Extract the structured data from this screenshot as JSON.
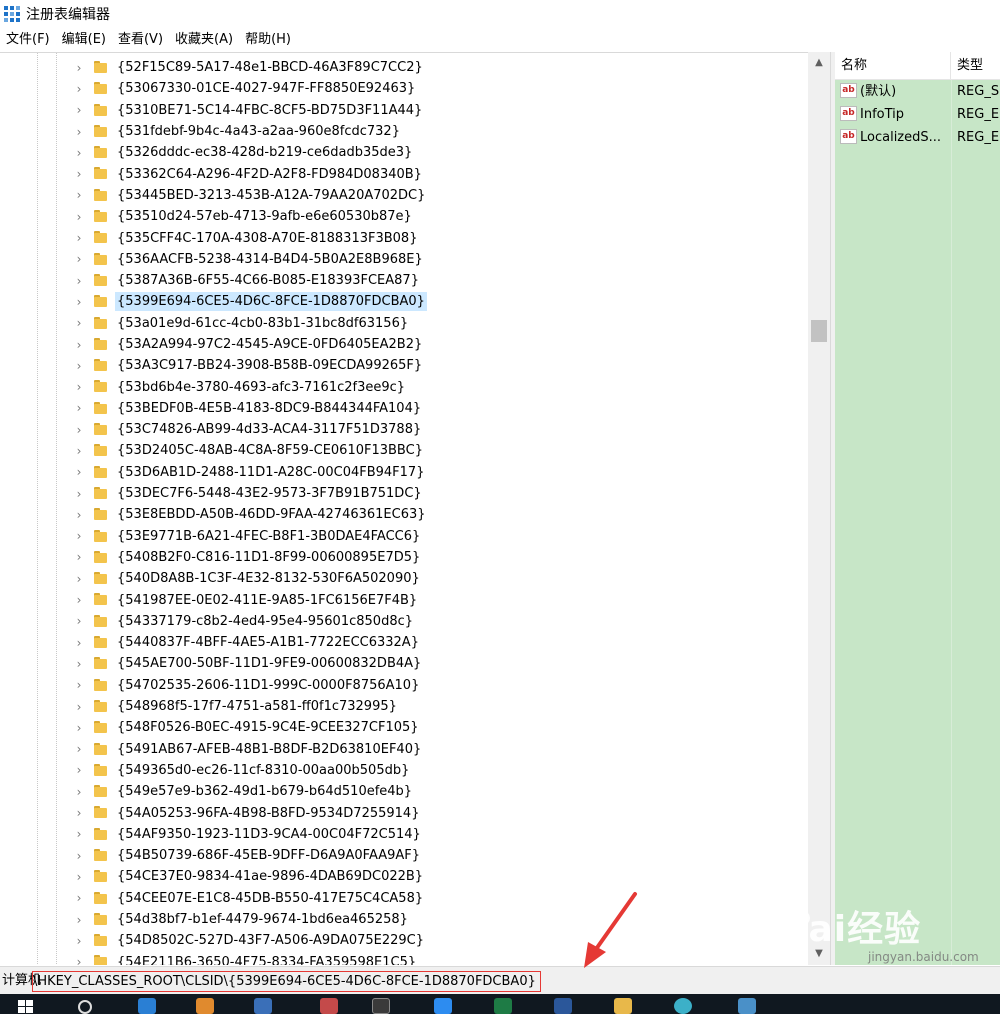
{
  "window": {
    "title": "注册表编辑器"
  },
  "menu": [
    "文件(F)",
    "编辑(E)",
    "查看(V)",
    "收藏夹(A)",
    "帮助(H)"
  ],
  "tree": {
    "selected_index": 11,
    "items": [
      "{52F15C89-5A17-48e1-BBCD-46A3F89C7CC2}",
      "{53067330-01CE-4027-947F-FF8850E92463}",
      "{5310BE71-5C14-4FBC-8CF5-BD75D3F11A44}",
      "{531fdebf-9b4c-4a43-a2aa-960e8fcdc732}",
      "{5326dddc-ec38-428d-b219-ce6dadb35de3}",
      "{53362C64-A296-4F2D-A2F8-FD984D08340B}",
      "{53445BED-3213-453B-A12A-79AA20A702DC}",
      "{53510d24-57eb-4713-9afb-e6e60530b87e}",
      "{535CFF4C-170A-4308-A70E-8188313F3B08}",
      "{536AACFB-5238-4314-B4D4-5B0A2E8B968E}",
      "{5387A36B-6F55-4C66-B085-E18393FCEA87}",
      "{5399E694-6CE5-4D6C-8FCE-1D8870FDCBA0}",
      "{53a01e9d-61cc-4cb0-83b1-31bc8df63156}",
      "{53A2A994-97C2-4545-A9CE-0FD6405EA2B2}",
      "{53A3C917-BB24-3908-B58B-09ECDA99265F}",
      "{53bd6b4e-3780-4693-afc3-7161c2f3ee9c}",
      "{53BEDF0B-4E5B-4183-8DC9-B844344FA104}",
      "{53C74826-AB99-4d33-ACA4-3117F51D3788}",
      "{53D2405C-48AB-4C8A-8F59-CE0610F13BBC}",
      "{53D6AB1D-2488-11D1-A28C-00C04FB94F17}",
      "{53DEC7F6-5448-43E2-9573-3F7B91B751DC}",
      "{53E8EBDD-A50B-46DD-9FAA-42746361EC63}",
      "{53E9771B-6A21-4FEC-B8F1-3B0DAE4FACC6}",
      "{5408B2F0-C816-11D1-8F99-00600895E7D5}",
      "{540D8A8B-1C3F-4E32-8132-530F6A502090}",
      "{541987EE-0E02-411E-9A85-1FC6156E7F4B}",
      "{54337179-c8b2-4ed4-95e4-95601c850d8c}",
      "{5440837F-4BFF-4AE5-A1B1-7722ECC6332A}",
      "{545AE700-50BF-11D1-9FE9-00600832DB4A}",
      "{54702535-2606-11D1-999C-0000F8756A10}",
      "{548968f5-17f7-4751-a581-ff0f1c732995}",
      "{548F0526-B0EC-4915-9C4E-9CEE327CF105}",
      "{5491AB67-AFEB-48B1-B8DF-B2D63810EF40}",
      "{549365d0-ec26-11cf-8310-00aa00b505db}",
      "{549e57e9-b362-49d1-b679-b64d510efe4b}",
      "{54A05253-96FA-4B98-B8FD-9534D7255914}",
      "{54AF9350-1923-11D3-9CA4-00C04F72C514}",
      "{54B50739-686F-45EB-9DFF-D6A9A0FAA9AF}",
      "{54CE37E0-9834-41ae-9896-4DAB69DC022B}",
      "{54CEE07E-E1C8-45DB-B550-417E75C4CA58}",
      "{54d38bf7-b1ef-4479-9674-1bd6ea465258}",
      "{54D8502C-527D-43F7-A506-A9DA075E229C}",
      "{54E211B6-3650-4F75-8334-FA359598E1C5}"
    ]
  },
  "values": {
    "headers": {
      "name": "名称",
      "type": "类型"
    },
    "rows": [
      {
        "name": "(默认)",
        "type": "REG_S"
      },
      {
        "name": "InfoTip",
        "type": "REG_E"
      },
      {
        "name": "LocalizedS...",
        "type": "REG_E"
      }
    ]
  },
  "status": {
    "prefix": "计算机",
    "path": "\\HKEY_CLASSES_ROOT\\CLSID\\{5399E694-6CE5-4D6C-8FCE-1D8870FDCBA0}"
  },
  "watermark": {
    "logo_text": "Bai经验",
    "url": "jingyan.baidu.com"
  },
  "colors": {
    "selection": "#cce8ff",
    "values_bg": "#c7e6c7",
    "annotation_red": "#e53935"
  }
}
